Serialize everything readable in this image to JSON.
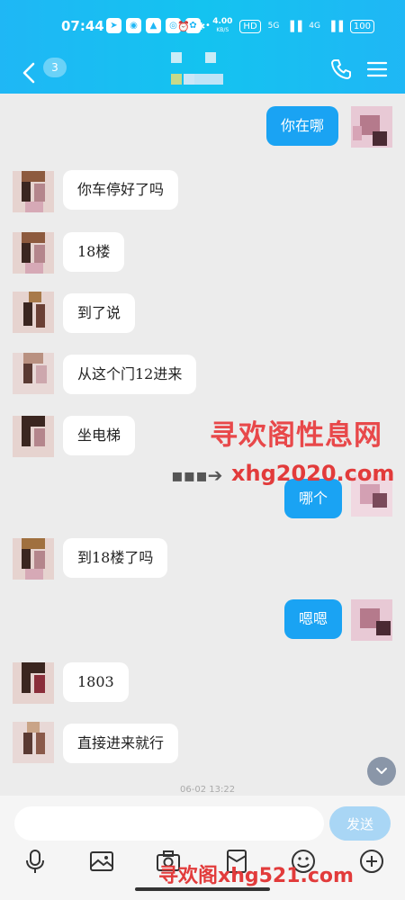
{
  "status_bar": {
    "time": "07:44",
    "speed": "4.00",
    "speed_unit": "KB/S",
    "hd": "HD",
    "signal1": "5G",
    "signal2": "4G",
    "battery": "100"
  },
  "header": {
    "unread_count": "3"
  },
  "messages": [
    {
      "dir": "out",
      "text": "你在哪"
    },
    {
      "dir": "in",
      "text": "你车停好了吗"
    },
    {
      "dir": "in",
      "text": "18楼"
    },
    {
      "dir": "in",
      "text": "到了说"
    },
    {
      "dir": "in",
      "text": "从这个门12进来"
    },
    {
      "dir": "in",
      "text": "坐电梯"
    },
    {
      "dir": "out",
      "text": "哪个"
    },
    {
      "dir": "in",
      "text": "到18楼了吗"
    },
    {
      "dir": "out",
      "text": "嗯嗯"
    },
    {
      "dir": "in",
      "text": "1803"
    },
    {
      "dir": "in",
      "text": "直接进来就行"
    }
  ],
  "timestamp": "06-02 13:22",
  "input": {
    "placeholder": "",
    "send_label": "发送"
  },
  "watermark": {
    "title": "寻欢阁性息网",
    "url": "xhg2020.com",
    "bottom": "寻欢阁xhg521.com"
  },
  "colors": {
    "header": "#1fb7f5",
    "bubble_out": "#1aa3f3",
    "bubble_in": "#ffffff",
    "watermark": "#e23b3b"
  },
  "icons": [
    "back-icon",
    "phone-icon",
    "menu-icon",
    "mic-icon",
    "image-icon",
    "camera-icon",
    "red-packet-icon",
    "emoji-icon",
    "plus-icon",
    "chevron-down-icon"
  ]
}
